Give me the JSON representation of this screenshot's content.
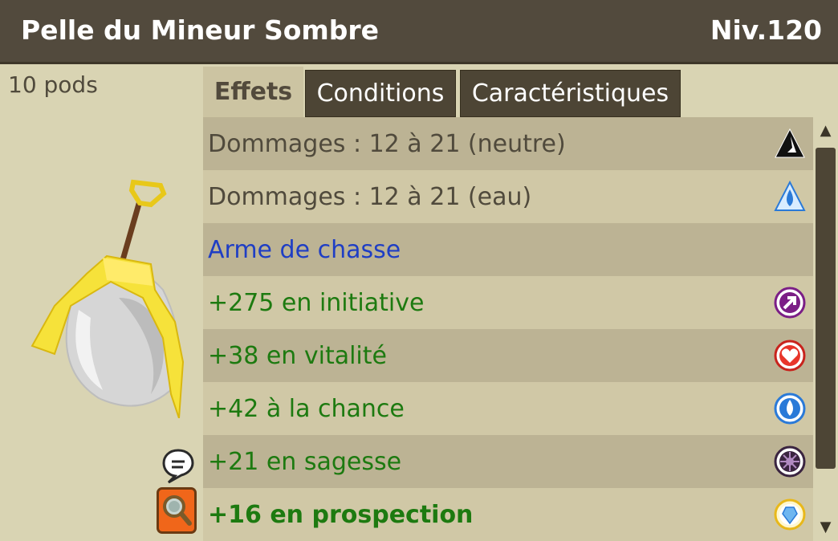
{
  "header": {
    "title": "Pelle du Mineur Sombre",
    "level": "Niv.120"
  },
  "item": {
    "weight": "10 pods"
  },
  "tabs": [
    {
      "label": "Effets",
      "active": true
    },
    {
      "label": "Conditions",
      "active": false
    },
    {
      "label": "Caractéristiques",
      "active": false
    }
  ],
  "effects": [
    {
      "text": "Dommages : 12 à 21 (neutre)",
      "color": "#504a3c",
      "icon": "neutral-element-icon"
    },
    {
      "text": "Dommages : 12 à 21 (eau)",
      "color": "#504a3c",
      "icon": "water-element-icon"
    },
    {
      "text": "Arme de chasse",
      "color": "#1f3ec4",
      "icon": ""
    },
    {
      "text": "+275 en initiative",
      "color": "#1d7a10",
      "icon": "initiative-icon"
    },
    {
      "text": "+38 en vitalité",
      "color": "#1d7a10",
      "icon": "vitality-heart-icon"
    },
    {
      "text": "+42 à la chance",
      "color": "#1d7a10",
      "icon": "chance-drop-icon"
    },
    {
      "text": "+21 en sagesse",
      "color": "#1d7a10",
      "icon": "wisdom-icon"
    },
    {
      "text": "+16 en prospection",
      "color": "#1d7a10",
      "icon": "prospection-icon",
      "bold": true
    }
  ],
  "colors": {
    "header_bg": "#524a3d",
    "bonus_green": "#1d7a10",
    "special_blue": "#1f3ec4",
    "damage_text": "#504a3c"
  }
}
